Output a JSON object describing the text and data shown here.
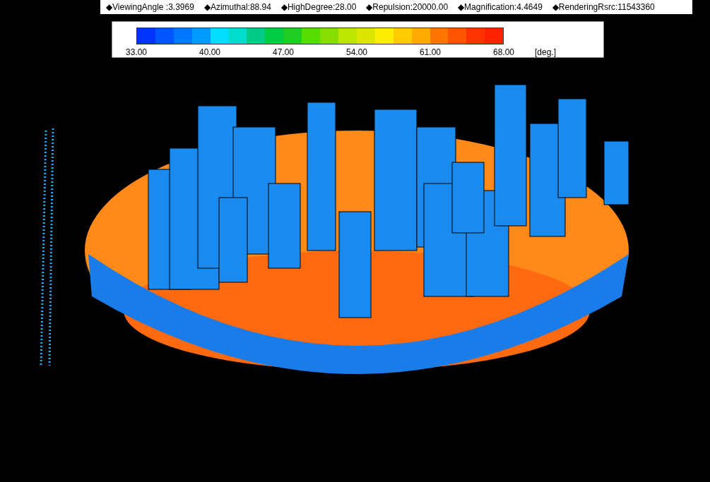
{
  "status_bar": [
    {
      "text": "◆ViewingAngle :3.3969"
    },
    {
      "text": "◆Azimuthal:88.94"
    },
    {
      "text": "◆HighDegree:28.00"
    },
    {
      "text": "◆Repulsion:20000.00"
    },
    {
      "text": "◆Magnification:4.4649"
    },
    {
      "text": "◆RenderingRsrc:11543360"
    }
  ],
  "legend": {
    "swatches": [
      {
        "color": "#0033ff"
      },
      {
        "color": "#0055ff"
      },
      {
        "color": "#0077ff"
      },
      {
        "color": "#0099ff"
      },
      {
        "color": "#00ddff"
      },
      {
        "color": "#00ddcc"
      },
      {
        "color": "#00cc88"
      },
      {
        "color": "#00cc44"
      },
      {
        "color": "#22cc22"
      },
      {
        "color": "#55dd00"
      },
      {
        "color": "#88dd00"
      },
      {
        "color": "#bbe600"
      },
      {
        "color": "#dde600"
      },
      {
        "color": "#ffee00"
      },
      {
        "color": "#ffcc00"
      },
      {
        "color": "#ffaa00"
      },
      {
        "color": "#ff7700"
      },
      {
        "color": "#ff5500"
      },
      {
        "color": "#ff3300"
      },
      {
        "color": "#ff2200"
      }
    ],
    "ticks": [
      "33.00",
      "40.00",
      "47.00",
      "54.00",
      "61.00",
      "68.00"
    ],
    "unit": "[deg.]"
  }
}
